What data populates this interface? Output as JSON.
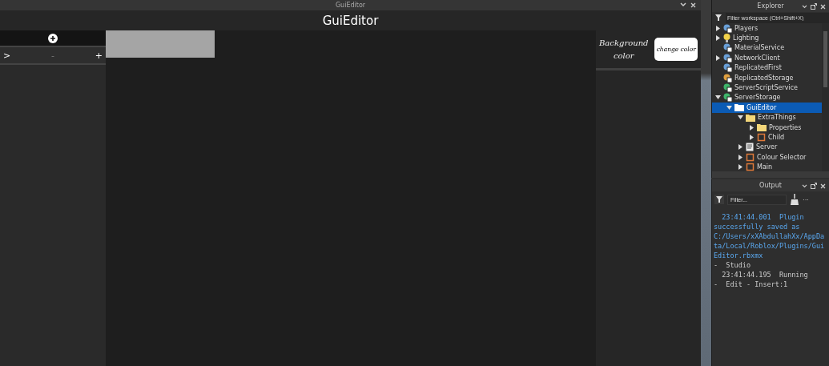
{
  "plugin_window": {
    "title": "GuiEditor",
    "header": "GuiEditor",
    "row_controls": {
      "expand": ">",
      "minus": "-",
      "plus": "+"
    },
    "background_label": "Background color",
    "change_color_button": "change color"
  },
  "explorer": {
    "title": "Explorer",
    "filter_placeholder": "Filter workspace (Ctrl+Shift+X)",
    "items": [
      {
        "label": "Players",
        "kind": "service",
        "expanded": false,
        "selected": false
      },
      {
        "label": "Lighting",
        "kind": "bulb",
        "expanded": false,
        "selected": false
      },
      {
        "label": "MaterialService",
        "kind": "service",
        "selected": false
      },
      {
        "label": "NetworkClient",
        "kind": "service",
        "expanded": false,
        "selected": false
      },
      {
        "label": "ReplicatedFirst",
        "kind": "service",
        "selected": false
      },
      {
        "label": "ReplicatedStorage",
        "kind": "storage",
        "selected": false
      },
      {
        "label": "ServerScriptService",
        "kind": "green",
        "selected": false
      },
      {
        "label": "ServerStorage",
        "kind": "green",
        "expanded": true,
        "selected": false,
        "children": [
          {
            "label": "GuiEditor",
            "kind": "folder",
            "expanded": true,
            "selected": true,
            "children": [
              {
                "label": "ExtraThings",
                "kind": "folder",
                "expanded": true,
                "selected": false,
                "children": [
                  {
                    "label": "Properties",
                    "kind": "folder",
                    "expanded": false,
                    "selected": false
                  },
                  {
                    "label": "Child",
                    "kind": "frame",
                    "expanded": false,
                    "selected": false
                  }
                ]
              },
              {
                "label": "Server",
                "kind": "script",
                "expanded": false,
                "selected": false
              },
              {
                "label": "Colour Selector",
                "kind": "frame",
                "expanded": false,
                "selected": false
              },
              {
                "label": "Main",
                "kind": "frame",
                "expanded": false,
                "selected": false
              }
            ]
          }
        ]
      }
    ]
  },
  "output": {
    "title": "Output",
    "filter_placeholder": "Filter...",
    "more": "···",
    "lines": [
      {
        "kind": "info",
        "text": "  23:41:44.001  Plugin successfully saved as C:/Users/xXAbdullahXx/AppData/Local/Roblox/Plugins/GuiEditor.rbxmx"
      },
      {
        "kind": "plain",
        "text": "-  Studio"
      },
      {
        "kind": "plain",
        "text": "  23:41:44.195  Running"
      },
      {
        "kind": "plain",
        "text": "-  Edit - Insert:1"
      }
    ]
  }
}
